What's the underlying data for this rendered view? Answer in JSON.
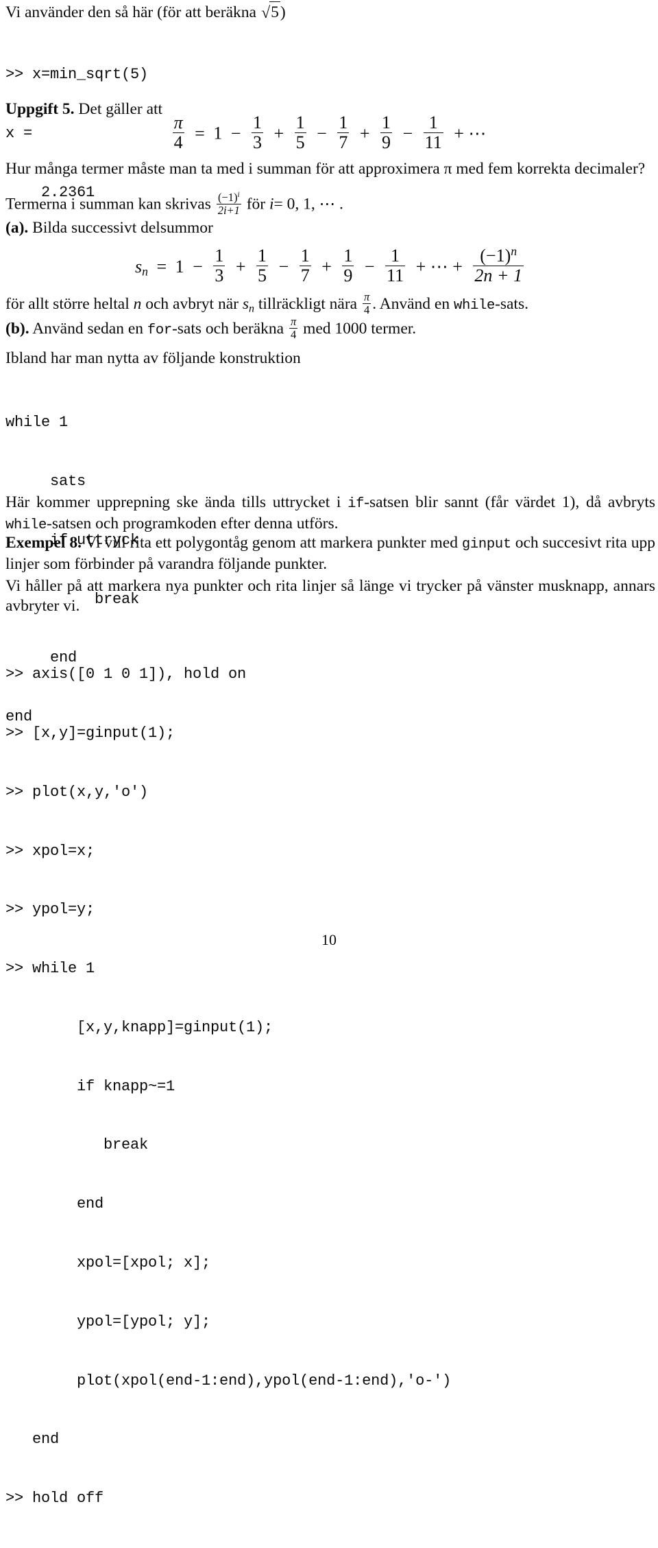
{
  "document": {
    "page_number": "10",
    "language": "sv"
  },
  "intro": {
    "line": "Vi använder den så här (för att beräkna ",
    "sqrt_radicand": "5",
    "line_end": ")"
  },
  "console1": {
    "lines": [
      ">> x=min_sqrt(5)",
      "x =",
      "    2.2361"
    ]
  },
  "exercise": {
    "label": "Uppgift 5.",
    "lead": "Det gäller att",
    "equation1": {
      "lhs_num": "π",
      "lhs_den": "4",
      "equals": "=",
      "first_term": "1",
      "terms": [
        {
          "op": "−",
          "num": "1",
          "den": "3"
        },
        {
          "op": "+",
          "num": "1",
          "den": "5"
        },
        {
          "op": "−",
          "num": "1",
          "den": "7"
        },
        {
          "op": "+",
          "num": "1",
          "den": "9"
        },
        {
          "op": "−",
          "num": "1",
          "den": "11"
        }
      ],
      "tail": "+ ⋯"
    },
    "question": "Hur många termer måste man ta med i summan för att approximera π med fem korrekta decimaler?",
    "terms_line": {
      "pre": "Termerna i summan kan skrivas ",
      "frac_num": "(−1)",
      "frac_num_sup": "i",
      "frac_den": "2i+1",
      "post": " för ",
      "index_var": "i",
      "index_values": "= 0, 1, ⋯ ."
    },
    "part_a": {
      "label": "(a).",
      "text": "Bilda successivt delsummor",
      "equation2": {
        "lhs": "s",
        "lhs_sub": "n",
        "equals": "=",
        "first_term": "1",
        "terms": [
          {
            "op": "−",
            "num": "1",
            "den": "3"
          },
          {
            "op": "+",
            "num": "1",
            "den": "5"
          },
          {
            "op": "−",
            "num": "1",
            "den": "7"
          },
          {
            "op": "+",
            "num": "1",
            "den": "9"
          },
          {
            "op": "−",
            "num": "1",
            "den": "11"
          }
        ],
        "tail_op": "+ ⋯ +",
        "tail_num": "(−1)",
        "tail_num_sup": "n",
        "tail_den": "2n + 1"
      },
      "after_eq_1": "för allt större heltal ",
      "after_eq_var1": "n",
      "after_eq_2": " och avbryt när ",
      "after_eq_var2": "s",
      "after_eq_var2_sub": "n",
      "after_eq_3": " tillräckligt nära ",
      "frac_num": "π",
      "frac_den": "4",
      "after_eq_4": ". Använd en ",
      "code_word": "while",
      "after_eq_5": "-sats."
    },
    "part_b": {
      "label": "(b).",
      "text_1": "Använd sedan en ",
      "code_word": "for",
      "text_2": "-sats och beräkna ",
      "frac_num": "π",
      "frac_den": "4",
      "text_3": " med 1000 termer."
    }
  },
  "construction": {
    "intro": "Ibland har man nytta av följande konstruktion",
    "code_lines": [
      "while 1",
      "     sats",
      "     if uttryck",
      "          break",
      "     end",
      "end"
    ],
    "explanation": {
      "part1": "Här kommer upprepning ske ända tills uttrycket i ",
      "code1": "if",
      "part2": "-satsen blir sannt (får värdet 1), då avbryts ",
      "code2": "while",
      "part3": "-satsen och programkoden efter denna utförs."
    }
  },
  "example": {
    "label": "Exempel 8.",
    "part1": "Vi vill rita ett polygontåg genom att markera punkter med ",
    "code1": "ginput",
    "part2": " och succesivt rita upp linjer som förbinder på varandra följande punkter.",
    "paragraph2": "Vi håller på att markera nya punkter och rita linjer så länge vi trycker på vänster musknapp, annars avbryter vi.",
    "code_lines": [
      ">> axis([0 1 0 1]), hold on",
      ">> [x,y]=ginput(1);",
      ">> plot(x,y,'o')",
      ">> xpol=x;",
      ">> ypol=y;",
      ">> while 1",
      "        [x,y,knapp]=ginput(1);",
      "        if knapp~=1",
      "           break",
      "        end",
      "        xpol=[xpol; x];",
      "        ypol=[ypol; y];",
      "        plot(xpol(end-1:end),ypol(end-1:end),'o-')",
      "   end",
      ">> hold off"
    ]
  }
}
